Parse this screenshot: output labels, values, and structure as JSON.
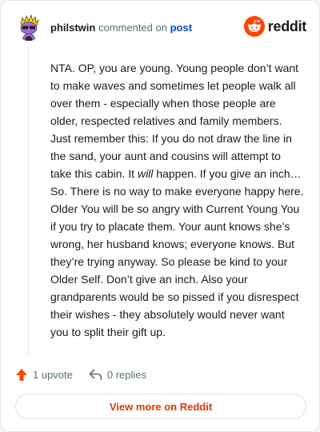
{
  "header": {
    "author": "philstwin",
    "commented_text": "commented on",
    "post_link": "post",
    "brand": "reddit",
    "icons": [
      "avatar-snoo",
      "reddit-logo-icon"
    ]
  },
  "comment": {
    "text_before_emphasis": "NTA. OP, you are young. Young people don’t want to make waves and sometimes let people walk all over them - especially when those people are older, respected relatives and family members. Just remember this: If you do not draw the line in the sand, your aunt and cousins will attempt to take this cabin. It ",
    "emphasis": "will",
    "text_after_emphasis": " happen. If you give an inch… So. There is no way to make everyone happy here. Older You will be so angry with Current Young You if you try to placate them. Your aunt knows she’s wrong, her husband knows; everyone knows. But they’re trying anyway. So please be kind to your Older Self. Don’t give an inch. Also your grandparents would be so pissed if you disrespect their wishes - they absolutely would never want you to split their gift up."
  },
  "actions": {
    "upvotes": "1 upvote",
    "replies": "0 replies",
    "icons": [
      "upvote-arrow-icon",
      "reply-arrow-icon"
    ]
  },
  "footer": {
    "view_more": "View more on Reddit"
  },
  "colors": {
    "reddit_orange": "#ff4500",
    "cta_text": "#d93a00",
    "link_blue": "#0b4cb3",
    "muted": "#576f76"
  }
}
